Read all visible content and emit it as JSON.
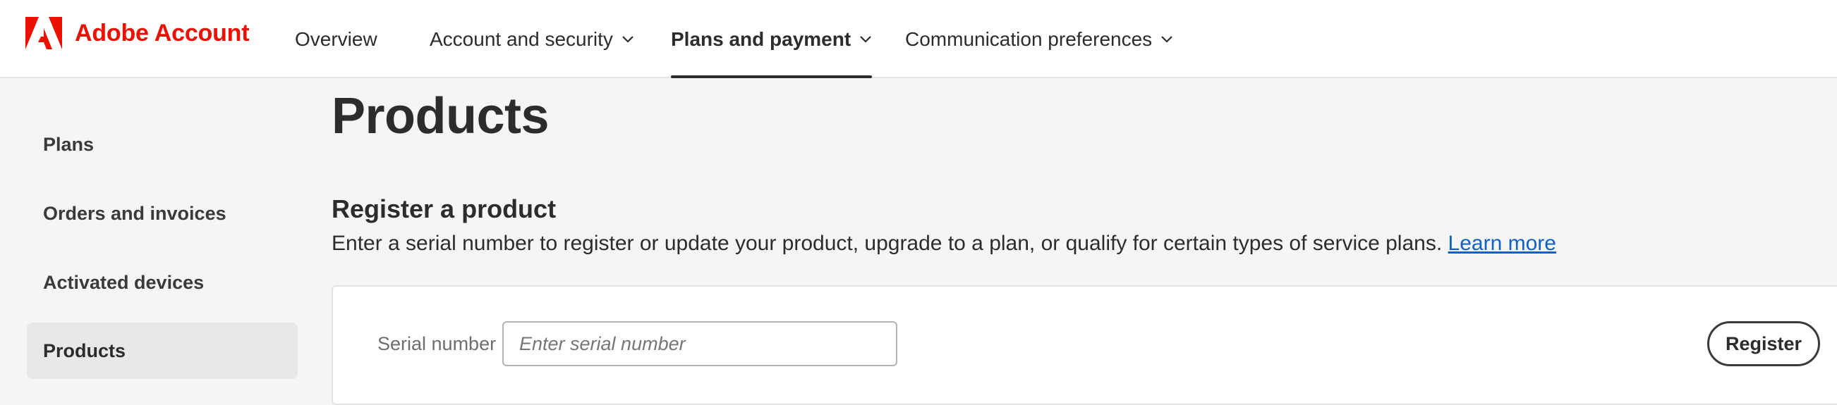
{
  "brand": {
    "name": "Adobe Account",
    "logo_color": "#eb1000"
  },
  "nav": {
    "items": [
      {
        "label": "Overview",
        "has_menu": false,
        "active": false
      },
      {
        "label": "Account and security",
        "has_menu": true,
        "active": false
      },
      {
        "label": "Plans and payment",
        "has_menu": true,
        "active": true
      },
      {
        "label": "Communication preferences",
        "has_menu": true,
        "active": false
      }
    ]
  },
  "sidebar": {
    "items": [
      {
        "label": "Plans",
        "selected": false
      },
      {
        "label": "Orders and invoices",
        "selected": false
      },
      {
        "label": "Activated devices",
        "selected": false
      },
      {
        "label": "Products",
        "selected": true
      }
    ]
  },
  "main": {
    "title": "Products",
    "register": {
      "title": "Register a product",
      "description": "Enter a serial number to register or update your product, upgrade to a plan, or qualify for certain types of service plans.",
      "learn_more_label": "Learn more",
      "serial_label": "Serial number",
      "serial_placeholder": "Enter serial number",
      "serial_value": "",
      "register_button_label": "Register"
    }
  },
  "colors": {
    "accent_red": "#eb1000",
    "link_blue": "#1062c4",
    "page_bg": "#f5f5f5"
  }
}
